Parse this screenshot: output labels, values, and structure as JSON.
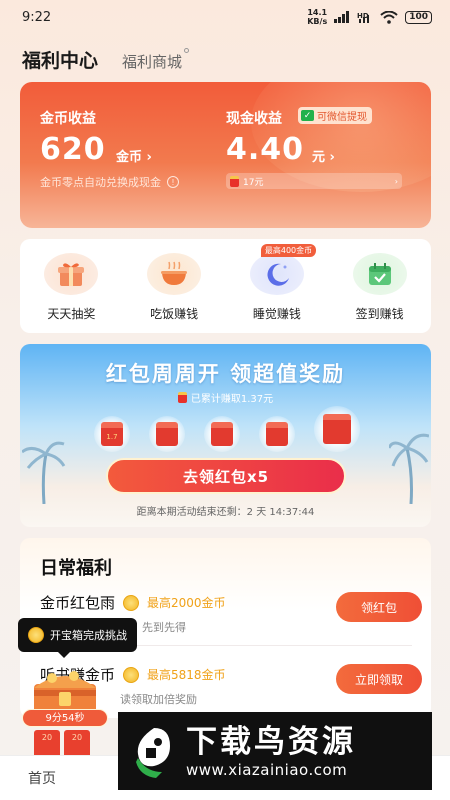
{
  "status_bar": {
    "time": "9:22",
    "net_speed": "14.1",
    "net_unit": "KB/s",
    "battery": "100",
    "icons": [
      "wifi-icon",
      "signal-icon",
      "hd-icon"
    ]
  },
  "header": {
    "title": "福利中心",
    "tab_mall": "福利商城"
  },
  "earnings": {
    "coin_label": "金币收益",
    "coin_value": "620",
    "coin_unit": "金币 ›",
    "coin_note": "金币零点自动兑换成现金",
    "cash_label": "现金收益",
    "wechat_badge": "可微信提现",
    "cash_value": "4.40",
    "cash_unit": "元 ›",
    "cash_bar_text": "17元"
  },
  "shortcuts": [
    {
      "label": "天天抽奖",
      "icon": "gift-icon"
    },
    {
      "label": "吃饭赚钱",
      "icon": "bowl-icon"
    },
    {
      "label": "睡觉赚钱",
      "icon": "moon-icon",
      "tag": "最高400金币"
    },
    {
      "label": "签到赚钱",
      "icon": "calendar-icon"
    }
  ],
  "promo": {
    "title": "红包周周开 领超值奖励",
    "subtitle": "已累计赚取1.37元",
    "first_envelope": "1.7",
    "button": "去领红包x5",
    "countdown": "距离本期活动结束还剩：2 天 14:37:44"
  },
  "daily": {
    "title": "日常福利",
    "tasks": [
      {
        "name": "金币红包雨",
        "reward": "最高2000金币",
        "desc": "袭，先到先得",
        "button": "领红包"
      },
      {
        "name": "听书赚金币",
        "reward": "最高5818金币",
        "desc": "读领取加倍奖励",
        "button": "立即领取"
      }
    ]
  },
  "floating": {
    "tooltip": "开宝箱完成挑战",
    "timer": "9分54秒",
    "envelopes": [
      "20",
      "20"
    ]
  },
  "tabbar": {
    "home": "首页"
  },
  "watermark": {
    "main": "下载鸟资源",
    "url": "www.xiazainiao.com"
  },
  "colors": {
    "accent": "#f25c3a",
    "button_gradient_start": "#f35a3c",
    "button_gradient_end": "#ea2e4a",
    "reward_text": "#f0a21a"
  }
}
